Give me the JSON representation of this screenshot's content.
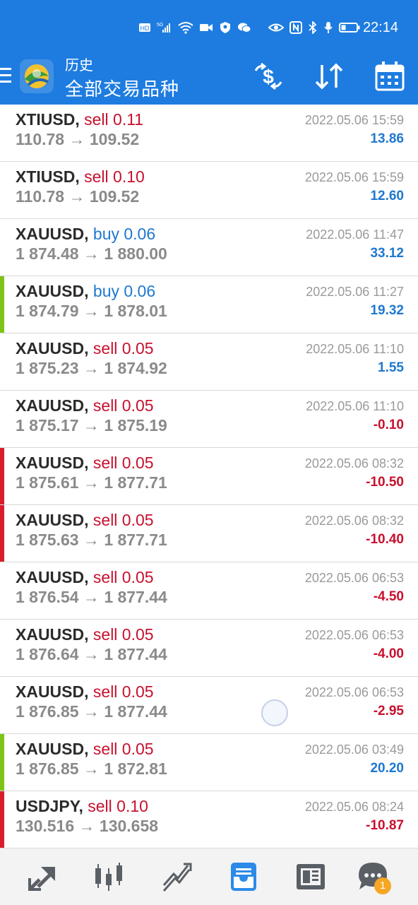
{
  "status_bar": {
    "left_icons": [
      "hd-icon",
      "5g-signal-icon",
      "wifi-icon",
      "video-icon",
      "shield-icon",
      "chat-icon"
    ],
    "right_icons": [
      "eye-icon",
      "nfc-icon",
      "bluetooth-icon",
      "mic-icon",
      "battery-icon"
    ],
    "time": "22:14"
  },
  "app_bar": {
    "subtitle": "历史",
    "title": "全部交易品种",
    "actions": [
      "currency-exchange-icon",
      "sort-icon",
      "calendar-icon"
    ]
  },
  "colors": {
    "primary": "#1E7CE0",
    "sell": "#C8102E",
    "buy": "#1E78D0",
    "green_marker": "#7DC416",
    "red_marker": "#D81E2C"
  },
  "trades": [
    {
      "symbol": "XTIUSD,",
      "side": "sell 0.11",
      "side_type": "sell",
      "open": "110.78",
      "arrow": "→",
      "close": "109.52",
      "time": "2022.05.06 15:59",
      "profit": "13.86",
      "profit_type": "pos",
      "marker": "none"
    },
    {
      "symbol": "XTIUSD,",
      "side": "sell 0.10",
      "side_type": "sell",
      "open": "110.78",
      "arrow": "→",
      "close": "109.52",
      "time": "2022.05.06 15:59",
      "profit": "12.60",
      "profit_type": "pos",
      "marker": "none"
    },
    {
      "symbol": "XAUUSD,",
      "side": "buy 0.06",
      "side_type": "buy",
      "open": "1 874.48",
      "arrow": "→",
      "close": "1 880.00",
      "time": "2022.05.06 11:47",
      "profit": "33.12",
      "profit_type": "pos",
      "marker": "none"
    },
    {
      "symbol": "XAUUSD,",
      "side": "buy 0.06",
      "side_type": "buy",
      "open": "1 874.79",
      "arrow": "→",
      "close": "1 878.01",
      "time": "2022.05.06 11:27",
      "profit": "19.32",
      "profit_type": "pos",
      "marker": "green"
    },
    {
      "symbol": "XAUUSD,",
      "side": "sell 0.05",
      "side_type": "sell",
      "open": "1 875.23",
      "arrow": "→",
      "close": "1 874.92",
      "time": "2022.05.06 11:10",
      "profit": "1.55",
      "profit_type": "pos",
      "marker": "none"
    },
    {
      "symbol": "XAUUSD,",
      "side": "sell 0.05",
      "side_type": "sell",
      "open": "1 875.17",
      "arrow": "→",
      "close": "1 875.19",
      "time": "2022.05.06 11:10",
      "profit": "-0.10",
      "profit_type": "neg",
      "marker": "none"
    },
    {
      "symbol": "XAUUSD,",
      "side": "sell 0.05",
      "side_type": "sell",
      "open": "1 875.61",
      "arrow": "→",
      "close": "1 877.71",
      "time": "2022.05.06 08:32",
      "profit": "-10.50",
      "profit_type": "neg",
      "marker": "red"
    },
    {
      "symbol": "XAUUSD,",
      "side": "sell 0.05",
      "side_type": "sell",
      "open": "1 875.63",
      "arrow": "→",
      "close": "1 877.71",
      "time": "2022.05.06 08:32",
      "profit": "-10.40",
      "profit_type": "neg",
      "marker": "red"
    },
    {
      "symbol": "XAUUSD,",
      "side": "sell 0.05",
      "side_type": "sell",
      "open": "1 876.54",
      "arrow": "→",
      "close": "1 877.44",
      "time": "2022.05.06 06:53",
      "profit": "-4.50",
      "profit_type": "neg",
      "marker": "none"
    },
    {
      "symbol": "XAUUSD,",
      "side": "sell 0.05",
      "side_type": "sell",
      "open": "1 876.64",
      "arrow": "→",
      "close": "1 877.44",
      "time": "2022.05.06 06:53",
      "profit": "-4.00",
      "profit_type": "neg",
      "marker": "none"
    },
    {
      "symbol": "XAUUSD,",
      "side": "sell 0.05",
      "side_type": "sell",
      "open": "1 876.85",
      "arrow": "→",
      "close": "1 877.44",
      "time": "2022.05.06 06:53",
      "profit": "-2.95",
      "profit_type": "neg",
      "marker": "none"
    },
    {
      "symbol": "XAUUSD,",
      "side": "sell 0.05",
      "side_type": "sell",
      "open": "1 876.85",
      "arrow": "→",
      "close": "1 872.81",
      "time": "2022.05.06 03:49",
      "profit": "20.20",
      "profit_type": "pos",
      "marker": "green"
    },
    {
      "symbol": "USDJPY,",
      "side": "sell 0.10",
      "side_type": "sell",
      "open": "130.516",
      "arrow": "→",
      "close": "130.658",
      "time": "2022.05.06 08:24",
      "profit": "-10.87",
      "profit_type": "neg",
      "marker": "red"
    }
  ],
  "bottom_nav": {
    "items": [
      "quotes-icon",
      "chart-icon",
      "trade-icon",
      "history-icon",
      "news-icon",
      "messages-icon"
    ],
    "active": "history-icon",
    "badge": "1"
  }
}
